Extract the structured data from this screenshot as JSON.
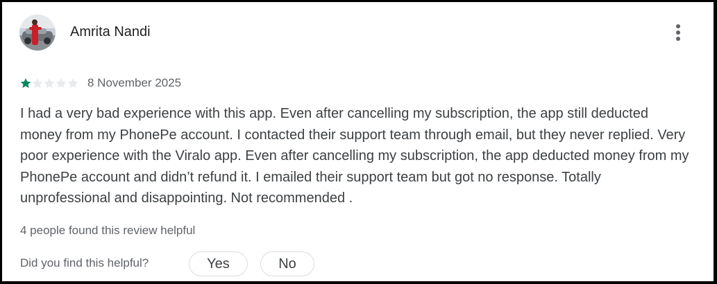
{
  "review": {
    "reviewer_name": "Amrita Nandi",
    "rating": 1,
    "max_rating": 5,
    "date": "8 November 2025",
    "text": "I had a very bad experience with this app. Even after cancelling my subscription, the app still deducted money from my PhonePe account. I contacted their support team through email, but they never replied. Very poor experience with the Viralo app. Even after cancelling my subscription, the app deducted money from my PhonePe account and didn’t refund it. I emailed their support team but got no response. Totally unprofessional and disappointing. Not recommended .",
    "helpful_count_text": "4 people found this review helpful"
  },
  "feedback": {
    "question": "Did you find this helpful?",
    "yes_label": "Yes",
    "no_label": "No"
  },
  "icons": {
    "menu": "more-vert-icon",
    "star_filled": "star-filled-icon",
    "star_empty": "star-empty-icon"
  },
  "colors": {
    "star_filled": "#01875f",
    "star_empty": "#e8eaed",
    "text_primary": "#202124",
    "text_secondary": "#5f6368"
  }
}
